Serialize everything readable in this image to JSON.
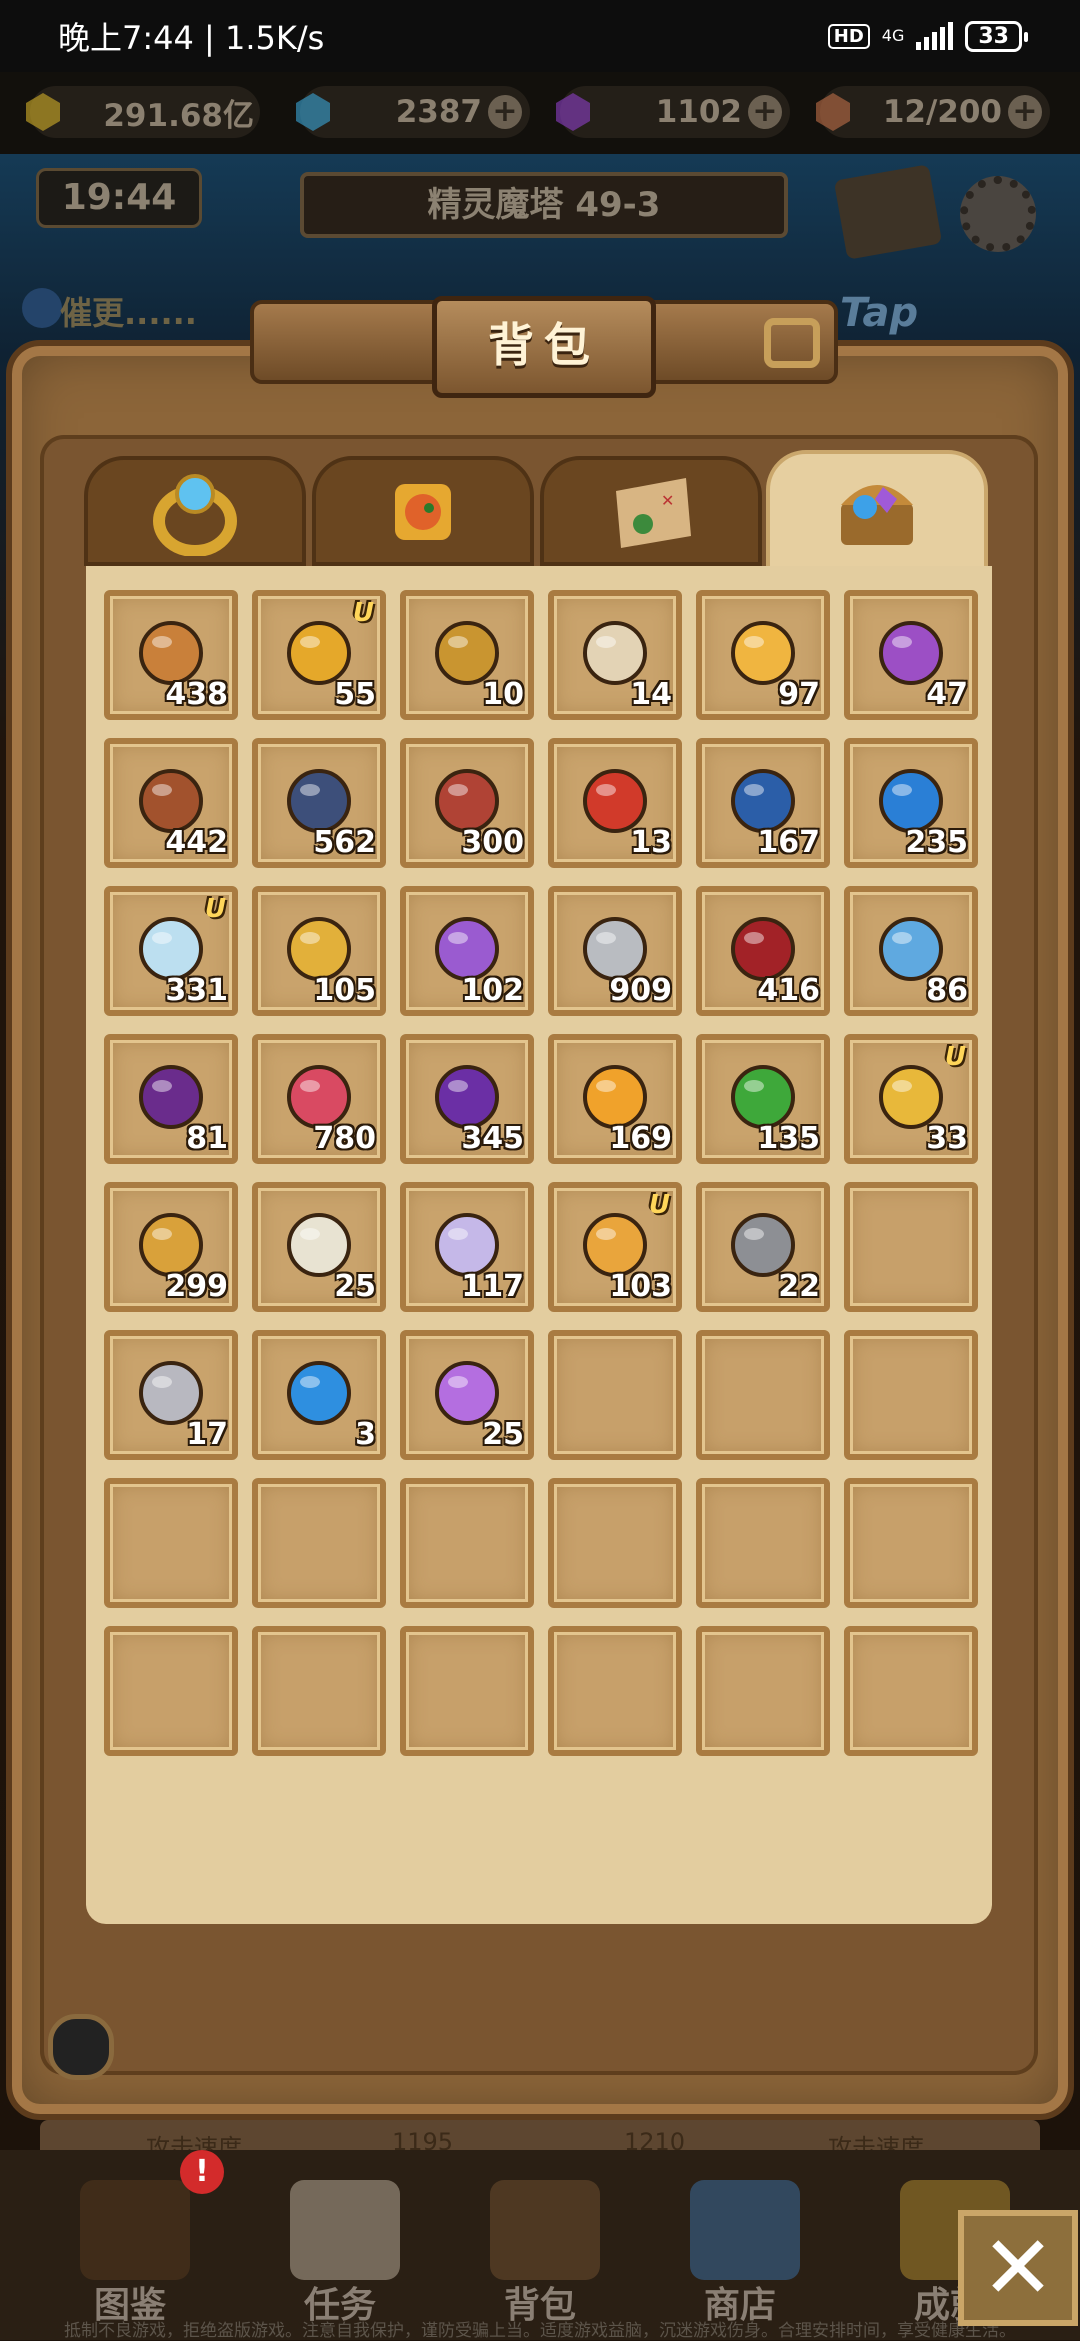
{
  "status_bar": {
    "time_speed": "晚上7:44 | 1.5K/s",
    "hd": "HD",
    "network": "4G",
    "battery": "33"
  },
  "currencies": [
    {
      "icon": "gold-gem-icon",
      "value": "291.68亿",
      "color": "#d4b12a",
      "has_plus": false
    },
    {
      "icon": "blue-diamond-icon",
      "value": "2387",
      "color": "#3aa7d8",
      "has_plus": true
    },
    {
      "icon": "purple-gem-icon",
      "value": "1102",
      "color": "#8e3fc8",
      "has_plus": true
    },
    {
      "icon": "meat-stamina-icon",
      "value": "12/200",
      "color": "#c0704a",
      "has_plus": true
    }
  ],
  "header": {
    "clock": "19:44",
    "stage": "精灵魔塔 49-3",
    "hint": "催更......",
    "tap_logo": "Tap"
  },
  "panel": {
    "title": "背包"
  },
  "tabs": [
    {
      "icon": "ring-icon",
      "active": false
    },
    {
      "icon": "puzzle-pet-icon",
      "active": false
    },
    {
      "icon": "treasure-map-icon",
      "active": false
    },
    {
      "icon": "treasure-chest-icon",
      "active": true
    }
  ],
  "items": [
    {
      "icon": "armor-token-icon",
      "count": "438",
      "u": false,
      "color": "#c9803a"
    },
    {
      "icon": "hourglass-icon",
      "count": "55",
      "u": true,
      "color": "#e5a82a"
    },
    {
      "icon": "gold-rune-icon",
      "count": "10",
      "u": false,
      "color": "#c99530"
    },
    {
      "icon": "scroll-key-icon",
      "count": "14",
      "u": false,
      "color": "#e3d3b5"
    },
    {
      "icon": "golden-ore-icon",
      "count": "97",
      "u": false,
      "color": "#f0b540"
    },
    {
      "icon": "rainbow-crystal-icon",
      "count": "47",
      "u": false,
      "color": "#9c4fc5"
    },
    {
      "icon": "sweet-potato-icon",
      "count": "442",
      "u": false,
      "color": "#a2522d"
    },
    {
      "icon": "dark-gear-icon",
      "count": "562",
      "u": false,
      "color": "#3d4f7a"
    },
    {
      "icon": "lightning-jar-icon",
      "count": "300",
      "u": false,
      "color": "#b04335"
    },
    {
      "icon": "fire-orb-icon",
      "count": "13",
      "u": false,
      "color": "#d13a2a"
    },
    {
      "icon": "blue-book-icon",
      "count": "167",
      "u": false,
      "color": "#2b5ea8"
    },
    {
      "icon": "water-orb-icon",
      "count": "235",
      "u": false,
      "color": "#2a7fd6"
    },
    {
      "icon": "ice-crystal-icon",
      "count": "331",
      "u": true,
      "color": "#bcdff0"
    },
    {
      "icon": "golden-star-icon",
      "count": "105",
      "u": false,
      "color": "#e2b03a"
    },
    {
      "icon": "purple-book-icon",
      "count": "102",
      "u": false,
      "color": "#9a5bd0"
    },
    {
      "icon": "silver-wheel-icon",
      "count": "909",
      "u": false,
      "color": "#b9bcc1"
    },
    {
      "icon": "red-ore-icon",
      "count": "416",
      "u": false,
      "color": "#a22227"
    },
    {
      "icon": "blue-feather-icon",
      "count": "86",
      "u": false,
      "color": "#5fa9e0"
    },
    {
      "icon": "fire-claw-icon",
      "count": "81",
      "u": false,
      "color": "#6a2c8c"
    },
    {
      "icon": "heart-potion-icon",
      "count": "780",
      "u": false,
      "color": "#d94a62"
    },
    {
      "icon": "purple-flame-icon",
      "count": "345",
      "u": false,
      "color": "#6b2fa5"
    },
    {
      "icon": "fire-eye-icon",
      "count": "169",
      "u": false,
      "color": "#f0a22b"
    },
    {
      "icon": "four-leaf-clover-icon",
      "count": "135",
      "u": false,
      "color": "#3ea83a"
    },
    {
      "icon": "winged-gem-icon",
      "count": "33",
      "u": true,
      "color": "#e8b83a"
    },
    {
      "icon": "gold-nugget-icon",
      "count": "299",
      "u": false,
      "color": "#d9a13a"
    },
    {
      "icon": "ticket-icon",
      "count": "25",
      "u": false,
      "color": "#e8e3d2"
    },
    {
      "icon": "rainbow-sword-icon",
      "count": "117",
      "u": false,
      "color": "#c5b8e8"
    },
    {
      "icon": "amber-crystal-icon",
      "count": "103",
      "u": true,
      "color": "#e9a53c"
    },
    {
      "icon": "spring-coil-icon",
      "count": "22",
      "u": false,
      "color": "#8d8f94"
    },
    {
      "icon": "",
      "count": "",
      "u": false,
      "color": ""
    },
    {
      "icon": "sand-bucket-icon",
      "count": "17",
      "u": false,
      "color": "#b8b8c0"
    },
    {
      "icon": "blue-orb-icon",
      "count": "3",
      "u": false,
      "color": "#2e8fe0"
    },
    {
      "icon": "purple-crystal-icon",
      "count": "25",
      "u": false,
      "color": "#b46ee0"
    }
  ],
  "total_slots": 48,
  "bottom_stats": {
    "left_label": "攻击速度",
    "v1": "1195",
    "v2": "1210",
    "right_label": "攻击速度"
  },
  "nav": [
    {
      "icon": "codex-book-icon",
      "label": "图鉴"
    },
    {
      "icon": "quest-scroll-icon",
      "label": "任务"
    },
    {
      "icon": "backpack-icon",
      "label": "背包"
    },
    {
      "icon": "shop-chest-icon",
      "label": "商店"
    },
    {
      "icon": "trophy-icon",
      "label": "成就"
    }
  ],
  "nav_badge": "!",
  "footer": "抵制不良游戏，拒绝盗版游戏。注意自我保护，谨防受骗上当。适度游戏益脑，沉迷游戏伤身。合理安排时间，享受健康生活。",
  "close_label": "✕"
}
